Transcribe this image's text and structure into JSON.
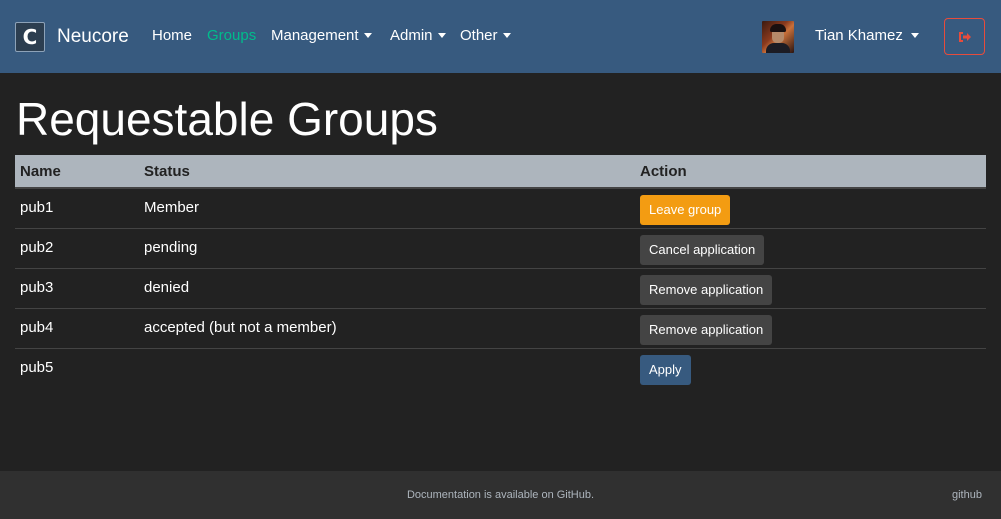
{
  "navbar": {
    "brand_letter": "C",
    "brand_name": "Neucore",
    "links": [
      {
        "label": "Home"
      },
      {
        "label": "Groups"
      },
      {
        "label": "Management"
      },
      {
        "label": "Admin"
      },
      {
        "label": "Other"
      }
    ],
    "user_name": "Tian Khamez",
    "logout_icon": "sign-out-icon"
  },
  "page": {
    "title": "Requestable Groups"
  },
  "table": {
    "headers": {
      "name": "Name",
      "status": "Status",
      "action": "Action"
    },
    "rows": [
      {
        "name": "pub1",
        "status": "Member",
        "action": "Leave group"
      },
      {
        "name": "pub2",
        "status": "pending",
        "action": "Cancel application"
      },
      {
        "name": "pub3",
        "status": "denied",
        "action": "Remove application"
      },
      {
        "name": "pub4",
        "status": "accepted (but not a member)",
        "action": "Remove application"
      },
      {
        "name": "pub5",
        "status": "",
        "action": "Apply"
      }
    ]
  },
  "footer": {
    "text": "Documentation is available on GitHub.",
    "link": "github"
  },
  "colors": {
    "navbar": "#375a7f",
    "active_link": "#00bc8c",
    "warning": "#f39c12",
    "secondary": "#444444",
    "primary": "#375a7f",
    "danger": "#e74c3c",
    "background": "#222222"
  }
}
